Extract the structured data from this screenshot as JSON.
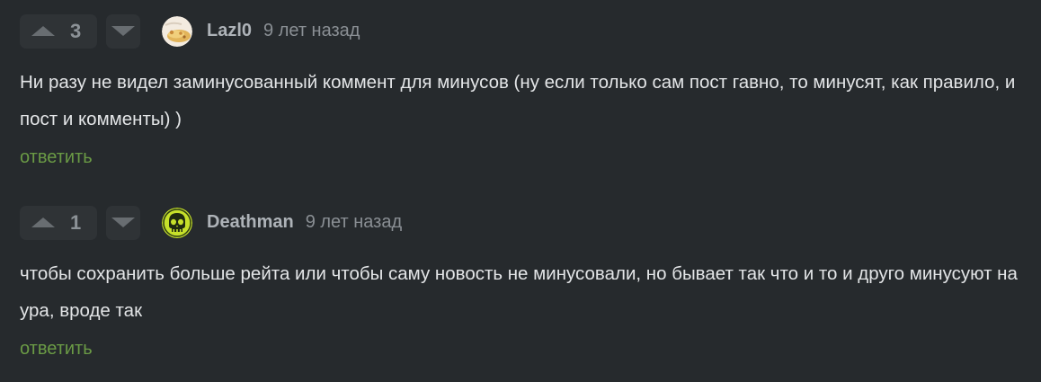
{
  "comments": [
    {
      "score": "3",
      "author": "Lazl0",
      "time": "9 лет назад",
      "text": "Ни разу не видел заминусованный коммент для минусов (ну если только сам пост гавно, то минусят, как правило, и пост и комменты) )",
      "reply_label": "ответить",
      "avatar_icon": "food-avatar-icon"
    },
    {
      "score": "1",
      "author": "Deathman",
      "time": "9 лет назад",
      "text": "чтобы сохранить больше рейта или чтобы саму новость не минусовали, но бывает так что и то и друго минусуют на ура, вроде так",
      "reply_label": "ответить",
      "avatar_icon": "skull-avatar-icon"
    }
  ],
  "colors": {
    "background": "#262a2d",
    "reply_link": "#6a9a45",
    "text": "#e3e5e7",
    "author": "#aeb3b8",
    "vote_button": "#2f3336"
  }
}
